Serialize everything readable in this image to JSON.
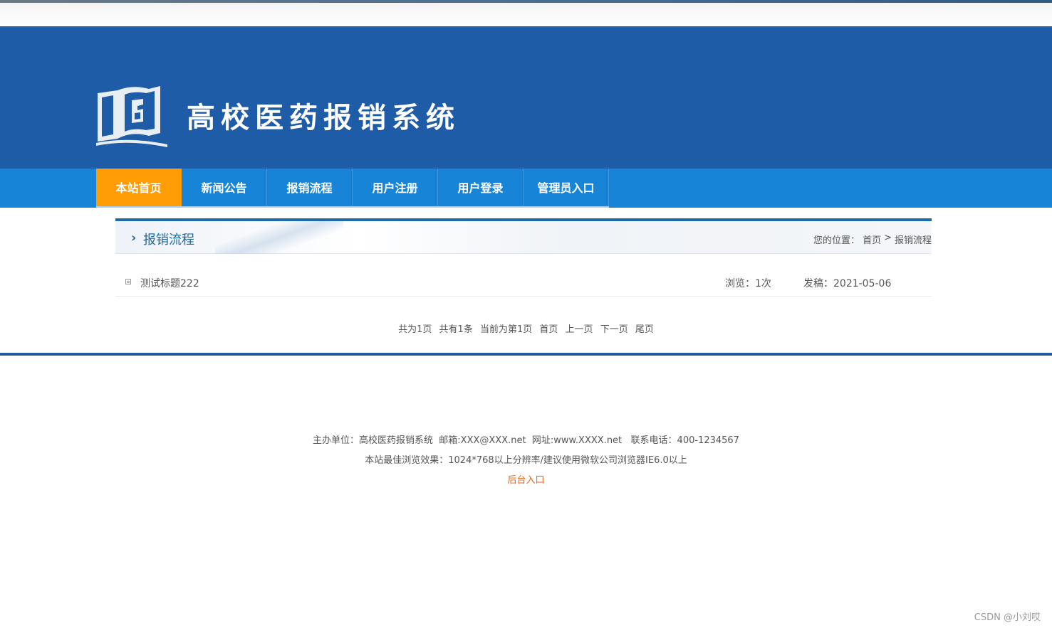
{
  "site": {
    "title": "高校医药报销系统"
  },
  "nav": {
    "items": [
      {
        "label": "本站首页",
        "active": true
      },
      {
        "label": "新闻公告",
        "active": false
      },
      {
        "label": "报销流程",
        "active": false
      },
      {
        "label": "用户注册",
        "active": false
      },
      {
        "label": "用户登录",
        "active": false
      },
      {
        "label": "管理员入口",
        "active": false
      }
    ]
  },
  "section": {
    "title": "报销流程",
    "breadcrumb_prefix": "您的位置：",
    "breadcrumb_home": "首页",
    "breadcrumb_sep": ">",
    "breadcrumb_current": "报销流程"
  },
  "list": {
    "rows": [
      {
        "title": "测试标题222",
        "views": "浏览：1次",
        "date": "发稿：2021-05-06"
      }
    ]
  },
  "pager": {
    "total_pages": "共为1页",
    "total_items": "共有1条",
    "current": "当前为第1页",
    "first": "首页",
    "prev": "上一页",
    "next": "下一页",
    "last": "尾页"
  },
  "footer": {
    "line1": "主办单位：高校医药报销系统  邮箱:XXX@XXX.net  网址:www.XXXX.net   联系电话：400-1234567",
    "line2": "本站最佳浏览效果：1024*768以上分辨率/建议使用微软公司浏览器IE6.0以上",
    "admin_link": "后台入口"
  },
  "watermark": "CSDN @小刘哎",
  "colors": {
    "banner": "#1e5ca8",
    "nav": "#1784d8",
    "nav_active": "#fd9c05",
    "accent": "#1d6aa7",
    "admin_link": "#e0661c"
  }
}
